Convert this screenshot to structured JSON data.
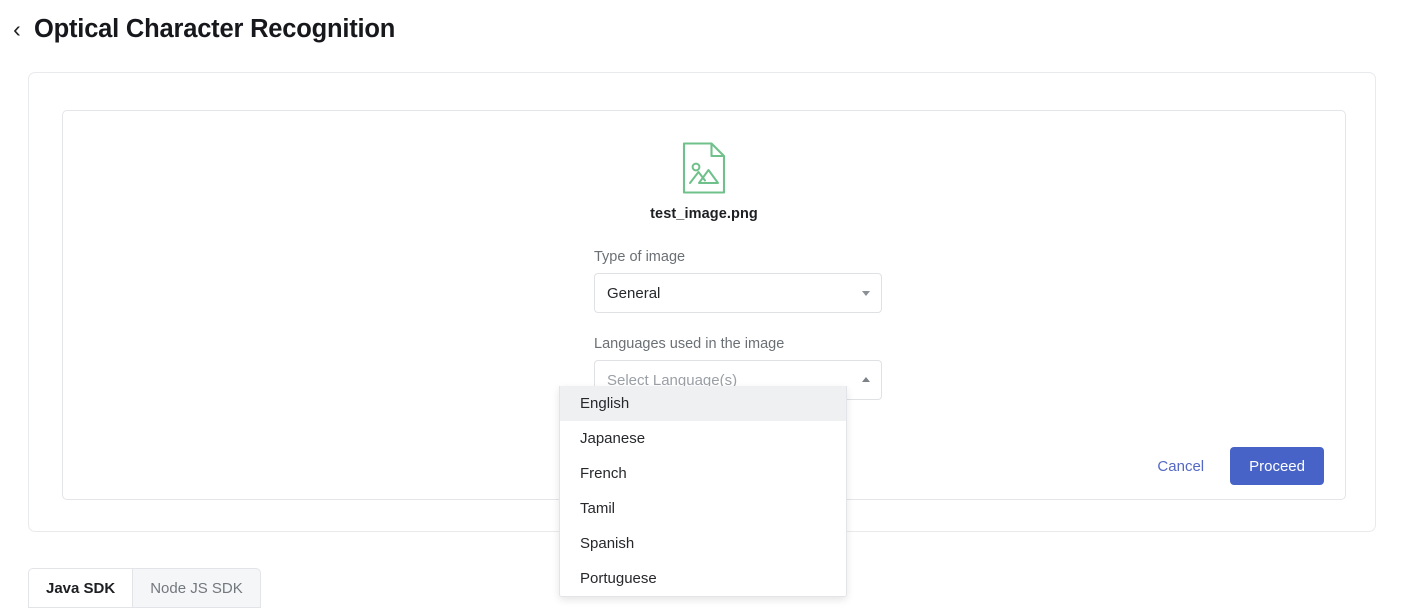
{
  "header": {
    "back_icon": "chevron-left-icon",
    "title": "Optical Character Recognition"
  },
  "file": {
    "icon": "image-file-icon",
    "name": "test_image.png",
    "icon_color": "#6fc08a"
  },
  "form": {
    "type_of_image": {
      "label": "Type of image",
      "value": "General",
      "caret": "chevron-down-icon"
    },
    "languages": {
      "label": "Languages used in the image",
      "placeholder": "Select Language(s)",
      "value": "",
      "caret": "chevron-up-icon",
      "open": true,
      "options": [
        "English",
        "Japanese",
        "French",
        "Tamil",
        "Spanish",
        "Portuguese"
      ],
      "highlighted_option": "English"
    }
  },
  "actions": {
    "cancel_label": "Cancel",
    "proceed_label": "Proceed",
    "proceed_color": "#4763c7",
    "cancel_color": "#5468c4"
  },
  "sdk_tabs": [
    {
      "label": "Java SDK",
      "active": true
    },
    {
      "label": "Node JS SDK",
      "active": false
    }
  ]
}
